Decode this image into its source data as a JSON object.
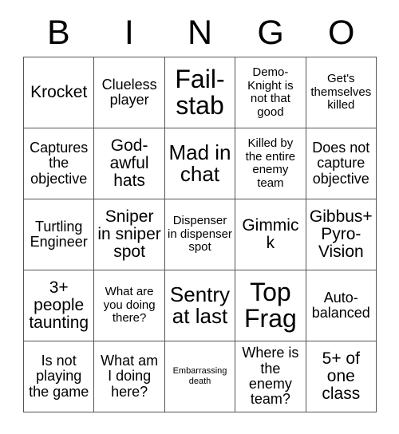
{
  "card": {
    "title": "BINGO",
    "grid_size": 5,
    "header_letters": [
      "B",
      "I",
      "N",
      "G",
      "O"
    ],
    "colors": {
      "background": "#ffffff",
      "text": "#000000",
      "grid_line": "#555555"
    },
    "rows": [
      [
        {
          "text": "Krocket",
          "size": "l"
        },
        {
          "text": "Clueless player",
          "size": "m"
        },
        {
          "text": "Fail-stab",
          "size": "xxl"
        },
        {
          "text": "Demo-Knight is not that good",
          "size": "s"
        },
        {
          "text": "Get's themselves killed",
          "size": "s"
        }
      ],
      [
        {
          "text": "Captures the objective",
          "size": "m"
        },
        {
          "text": "God-awful hats",
          "size": "l"
        },
        {
          "text": "Mad in chat",
          "size": "xl"
        },
        {
          "text": "Killed by the entire enemy team",
          "size": "s"
        },
        {
          "text": "Does not capture objective",
          "size": "m"
        }
      ],
      [
        {
          "text": "Turtling Engineer",
          "size": "m"
        },
        {
          "text": "Sniper in sniper spot",
          "size": "l"
        },
        {
          "text": "Dispenser in dispenser spot",
          "size": "s"
        },
        {
          "text": "Gimmick",
          "size": "l"
        },
        {
          "text": "Gibbus+ Pyro-Vision",
          "size": "l"
        }
      ],
      [
        {
          "text": "3+ people taunting",
          "size": "l"
        },
        {
          "text": "What are you doing there?",
          "size": "s"
        },
        {
          "text": "Sentry at last",
          "size": "xl"
        },
        {
          "text": "Top Frag",
          "size": "xxl"
        },
        {
          "text": "Auto-balanced",
          "size": "m"
        }
      ],
      [
        {
          "text": "Is not playing the game",
          "size": "m"
        },
        {
          "text": "What am I doing here?",
          "size": "m"
        },
        {
          "text": "Embarrassing death",
          "size": "xs"
        },
        {
          "text": "Where is the enemy team?",
          "size": "m"
        },
        {
          "text": "5+ of one class",
          "size": "l"
        }
      ]
    ]
  }
}
